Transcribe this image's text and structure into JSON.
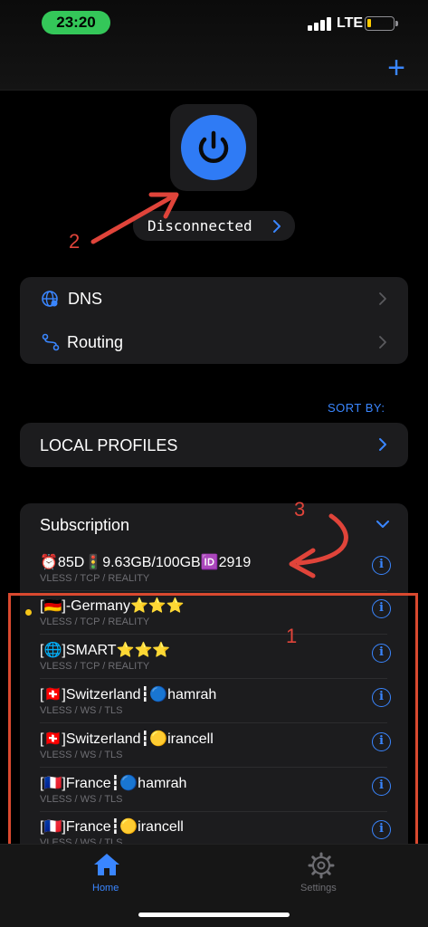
{
  "status_bar": {
    "time": "23:20",
    "network": "LTE"
  },
  "header": {
    "add_label": "+"
  },
  "connection": {
    "status": "Disconnected"
  },
  "settings_rows": [
    {
      "label": "DNS"
    },
    {
      "label": "Routing"
    }
  ],
  "sort": {
    "label": "SORT BY:"
  },
  "local_profiles": {
    "label": "LOCAL PROFILES"
  },
  "subscription": {
    "title": "Subscription",
    "info_row": {
      "title": "⏰85D🚦9.63GB/100GB🆔2919",
      "subtitle": "VLESS / TCP / REALITY"
    },
    "profiles": [
      {
        "title": "[🇩🇪]-Germany⭐⭐⭐",
        "subtitle": "VLESS / TCP / REALITY",
        "selected": true
      },
      {
        "title": "[🌐]SMART⭐⭐⭐",
        "subtitle": "VLESS / TCP / REALITY",
        "selected": false
      },
      {
        "title": "[🇨🇭]Switzerland┇🔵hamrah",
        "subtitle": "VLESS / WS / TLS",
        "selected": false
      },
      {
        "title": "[🇨🇭]Switzerland┇🟡irancell",
        "subtitle": "VLESS / WS / TLS",
        "selected": false
      },
      {
        "title": "[🇫🇷]France┇🔵hamrah",
        "subtitle": "VLESS / WS / TLS",
        "selected": false
      },
      {
        "title": "[🇫🇷]France┇🟡irancell",
        "subtitle": "VLESS / WS / TLS",
        "selected": false
      }
    ]
  },
  "info_glyph": "i",
  "annotations": {
    "one": "1",
    "two": "2",
    "three": "3"
  },
  "tabs": [
    {
      "label": "Home",
      "active": true,
      "icon": "house-icon"
    },
    {
      "label": "Settings",
      "active": false,
      "icon": "gear-icon"
    }
  ],
  "colors": {
    "accent": "#3a86ff",
    "power": "#2f7bf5",
    "annotation": "#d9492f",
    "time_pill": "#34c759",
    "selected_dot": "#f5c518"
  }
}
